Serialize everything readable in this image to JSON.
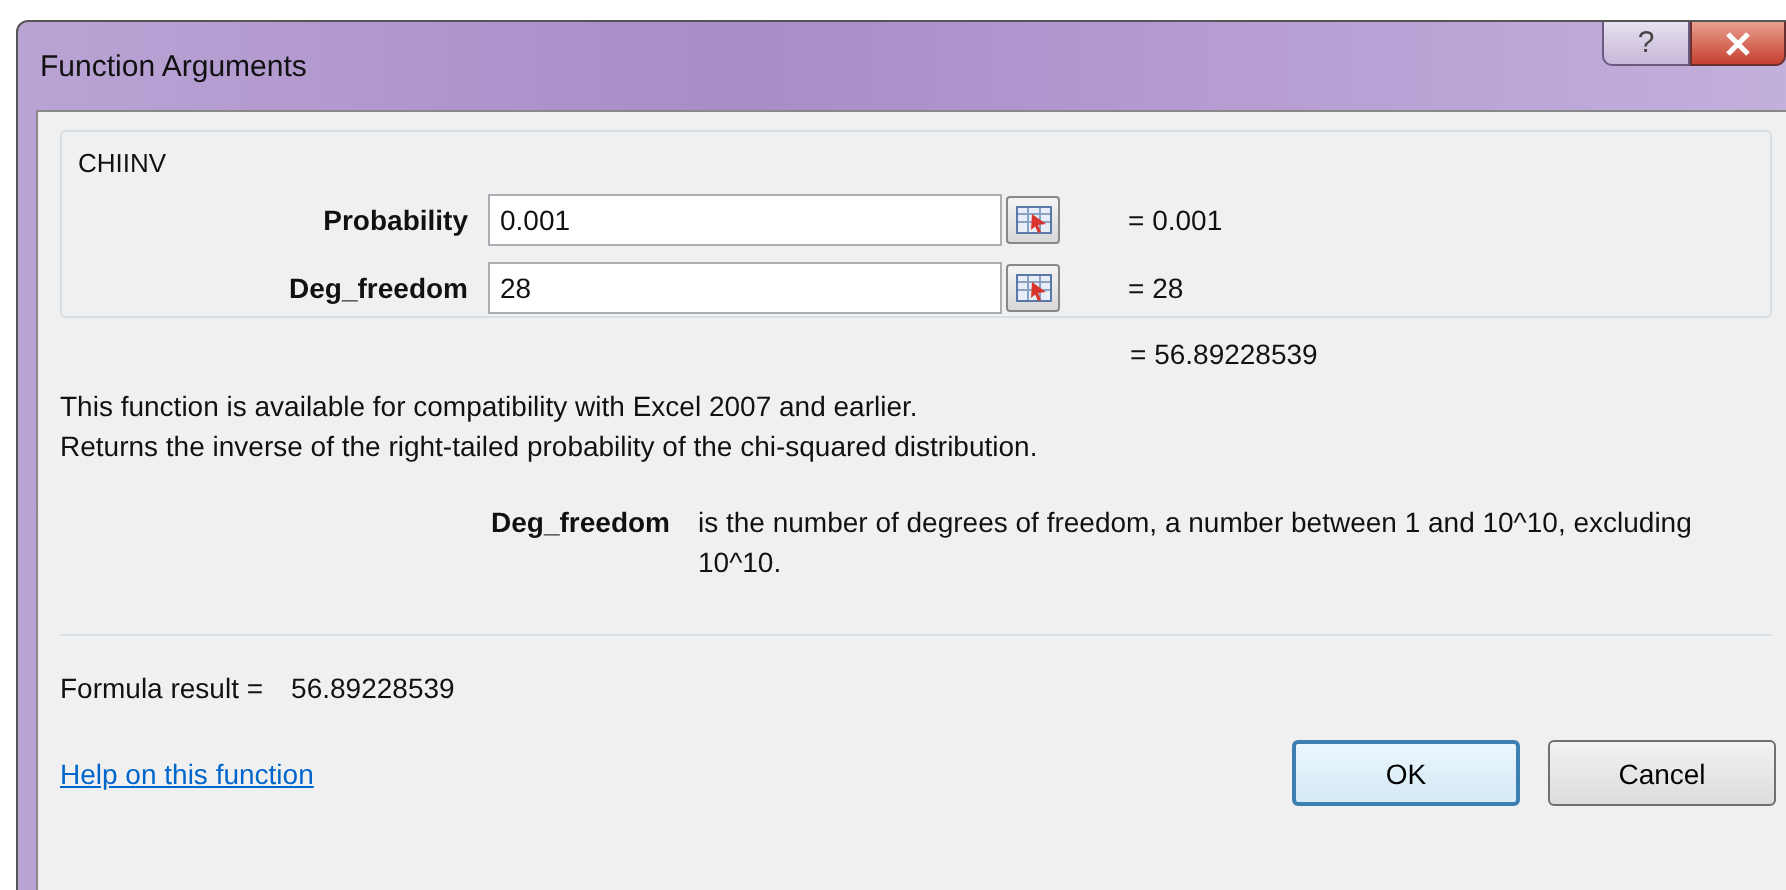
{
  "window": {
    "title": "Function Arguments",
    "help_glyph": "?"
  },
  "function_name": "CHIINV",
  "arguments": [
    {
      "label": "Probability",
      "value": "0.001",
      "result": "= 0.001"
    },
    {
      "label": "Deg_freedom",
      "value": "28",
      "result": "= 28"
    }
  ],
  "function_result": "= 56.89228539",
  "description": [
    "This function is available for compatibility with Excel 2007 and earlier.",
    "Returns the inverse of the right-tailed probability of the chi-squared distribution."
  ],
  "argument_help": {
    "label": "Deg_freedom",
    "text": "is the number of degrees of freedom, a number between 1 and 10^10, excluding 10^10."
  },
  "formula_result": {
    "label": "Formula result =",
    "value": "56.89228539"
  },
  "help_link": "Help on this function",
  "buttons": [
    {
      "label": "OK",
      "default": true
    },
    {
      "label": "Cancel",
      "default": false
    }
  ]
}
